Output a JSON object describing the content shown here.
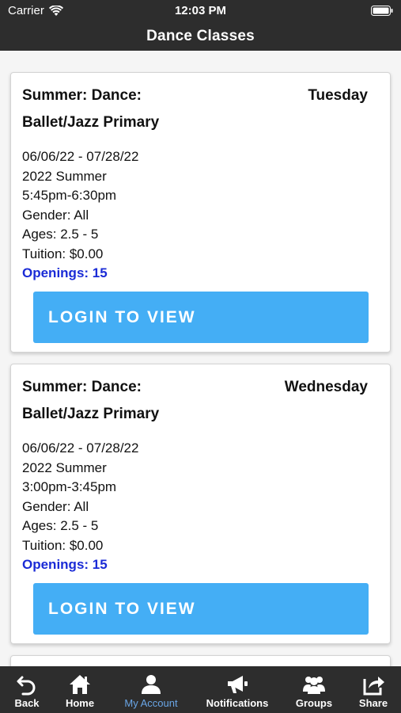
{
  "status_bar": {
    "carrier": "Carrier",
    "time": "12:03 PM",
    "wifi_icon": "wifi-icon",
    "battery_icon": "battery-icon"
  },
  "header": {
    "title": "Dance Classes"
  },
  "classes": [
    {
      "title": "Summer: Dance:",
      "day": "Tuesday",
      "subtitle": "Ballet/Jazz Primary",
      "dates": "06/06/22 - 07/28/22",
      "session": "2022 Summer",
      "time": "5:45pm-6:30pm",
      "gender": "Gender: All",
      "ages": "Ages: 2.5 - 5",
      "tuition": "Tuition: $0.00",
      "openings": "Openings: 15",
      "button_label": "LOGIN TO VIEW"
    },
    {
      "title": "Summer: Dance:",
      "day": "Wednesday",
      "subtitle": "Ballet/Jazz Primary",
      "dates": "06/06/22 - 07/28/22",
      "session": "2022 Summer",
      "time": "3:00pm-3:45pm",
      "gender": "Gender: All",
      "ages": "Ages: 2.5 - 5",
      "tuition": "Tuition: $0.00",
      "openings": "Openings: 15",
      "button_label": "LOGIN TO VIEW"
    }
  ],
  "tabbar": {
    "items": [
      {
        "label": "Back",
        "icon": "back-arrow-icon"
      },
      {
        "label": "Home",
        "icon": "home-icon"
      },
      {
        "label": "My Account",
        "icon": "user-icon",
        "active": true
      },
      {
        "label": "Notifications",
        "icon": "megaphone-icon"
      },
      {
        "label": "Groups",
        "icon": "group-icon"
      },
      {
        "label": "Share",
        "icon": "share-icon"
      }
    ]
  },
  "colors": {
    "bar_background": "#2d2d2d",
    "button_blue": "#44aef5",
    "openings_blue": "#1a2bd6",
    "active_tab": "#6aa6e6"
  }
}
